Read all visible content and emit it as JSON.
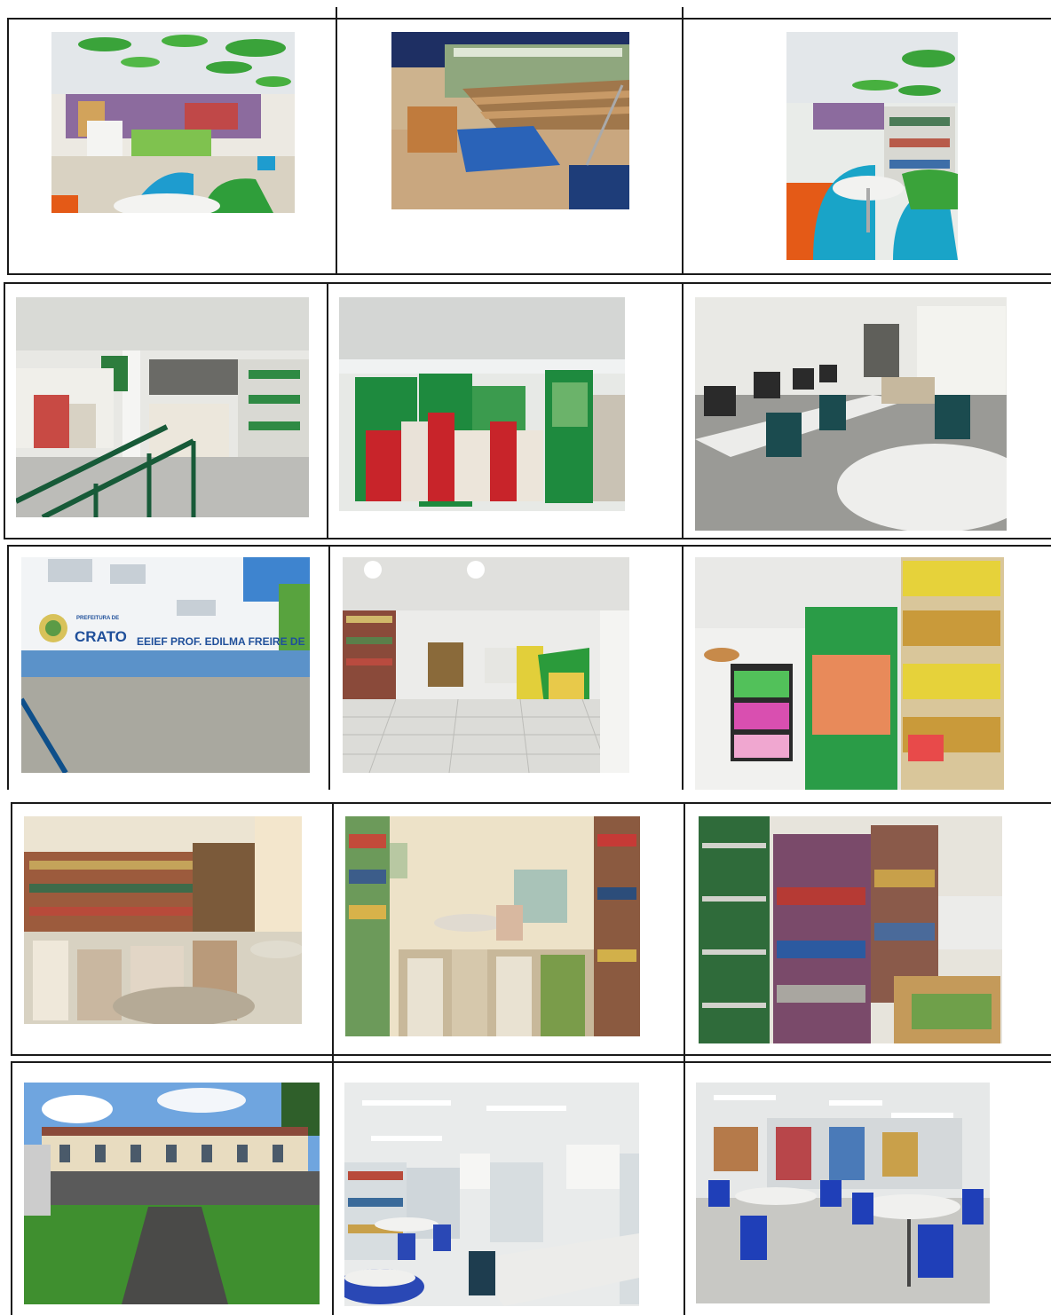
{
  "document": {
    "type": "photo-grid",
    "rows": 5,
    "columns": 3
  },
  "photos": [
    {
      "id": "r1c1",
      "subject": "library-children-reading-area",
      "colors": {
        "ceiling": "#e7ecee",
        "accent": "#3aa33a",
        "seat": "#1e9ccf"
      }
    },
    {
      "id": "r1c2",
      "subject": "amphitheater-steps-with-blue-rug",
      "colors": {
        "floor": "#c9a77f",
        "rug": "#2a63b8"
      }
    },
    {
      "id": "r1c3",
      "subject": "reading-corner-round-table",
      "colors": {
        "sofa": "#19a4c8",
        "chair": "#e45a17"
      }
    },
    {
      "id": "r2c1",
      "subject": "mezzanine-stairs-bookshelves",
      "colors": {
        "rail": "#175a38",
        "wall": "#e8e8e4"
      }
    },
    {
      "id": "r2c2",
      "subject": "green-book-displays",
      "colors": {
        "shelf": "#1e8a3e",
        "books": "#c8242a"
      }
    },
    {
      "id": "r2c3",
      "subject": "computer-room-round-table",
      "colors": {
        "chair": "#1b4b4f",
        "table": "#e9ecec"
      }
    },
    {
      "id": "r3c1",
      "subject": "school-facade",
      "colors": {
        "wall": "#f2f4f6",
        "band": "#5b92c9",
        "text": "#1f4f9a"
      }
    },
    {
      "id": "r3c2",
      "subject": "tiled-library-room",
      "colors": {
        "tile": "#dcdcd8",
        "panel": "#2b9b3b"
      }
    },
    {
      "id": "r3c3",
      "subject": "book-display-stands",
      "colors": {
        "panel": "#2a9c47",
        "book": "#e6d23a"
      }
    },
    {
      "id": "r4c1",
      "subject": "stacked-books-room",
      "colors": {
        "wall": "#ece4d2",
        "books": "#9c5b3d"
      }
    },
    {
      "id": "r4c2",
      "subject": "library-with-tables-and-stacks",
      "colors": {
        "wall": "#ede2c8",
        "books": "#6c9a5a"
      }
    },
    {
      "id": "r4c3",
      "subject": "tall-bookshelves",
      "colors": {
        "books": "#2f6b3a",
        "red": "#b63a34"
      }
    },
    {
      "id": "r5c1",
      "subject": "school-building-exterior",
      "colors": {
        "sky": "#6fa5df",
        "grass": "#3f8f2f",
        "building": "#e8dcc0"
      }
    },
    {
      "id": "r5c2",
      "subject": "reading-room-blue-chairs",
      "colors": {
        "chair": "#2a48b5",
        "shelf": "#d7dde0"
      }
    },
    {
      "id": "r5c3",
      "subject": "library-round-tables",
      "colors": {
        "chair": "#1f3fb8",
        "table": "#f0f0ee"
      }
    }
  ],
  "signage": {
    "town": "CRATO",
    "prefecture": "PREFEITURA DE",
    "school": "EEIEF PROF. EDILMA FREIRE DE OLIVEIRA"
  }
}
